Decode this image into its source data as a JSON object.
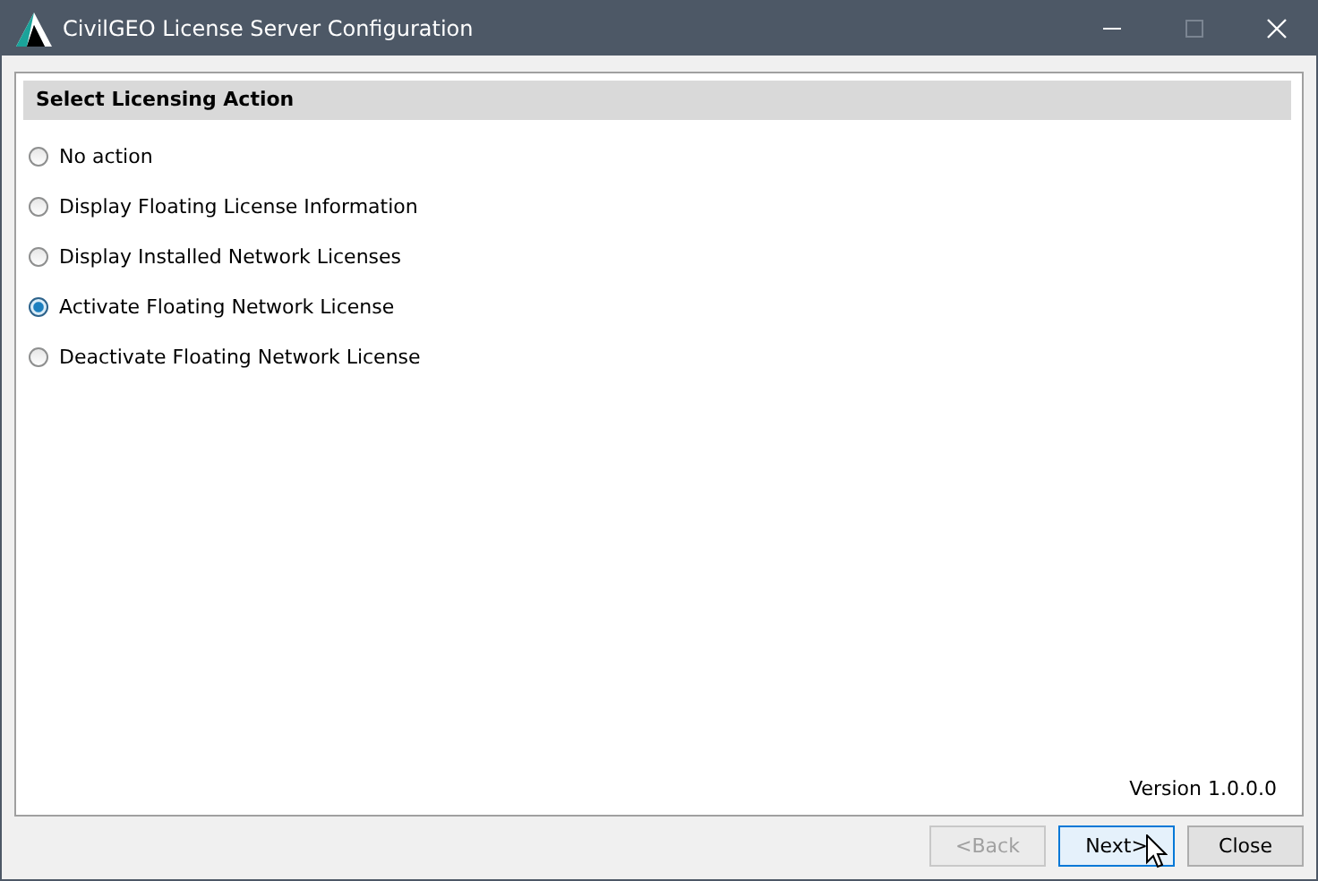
{
  "window": {
    "title": "CivilGEO License Server Configuration",
    "controls": [
      {
        "kind": "minimize",
        "disabled": false
      },
      {
        "kind": "maximize",
        "disabled": true
      },
      {
        "kind": "close",
        "disabled": false
      }
    ]
  },
  "section": {
    "title": "Select Licensing Action"
  },
  "options": [
    {
      "label": "No action",
      "selected": false
    },
    {
      "label": "Display Floating License Information",
      "selected": false
    },
    {
      "label": "Display Installed Network Licenses",
      "selected": false
    },
    {
      "label": "Activate Floating Network License",
      "selected": true
    },
    {
      "label": "Deactivate Floating Network License",
      "selected": false
    }
  ],
  "version": "Version 1.0.0.0",
  "buttons": [
    {
      "label": "<Back",
      "disabled": true,
      "highlighted": false
    },
    {
      "label": "Next>",
      "disabled": false,
      "highlighted": true
    },
    {
      "label": "Close",
      "disabled": false,
      "highlighted": false
    }
  ]
}
